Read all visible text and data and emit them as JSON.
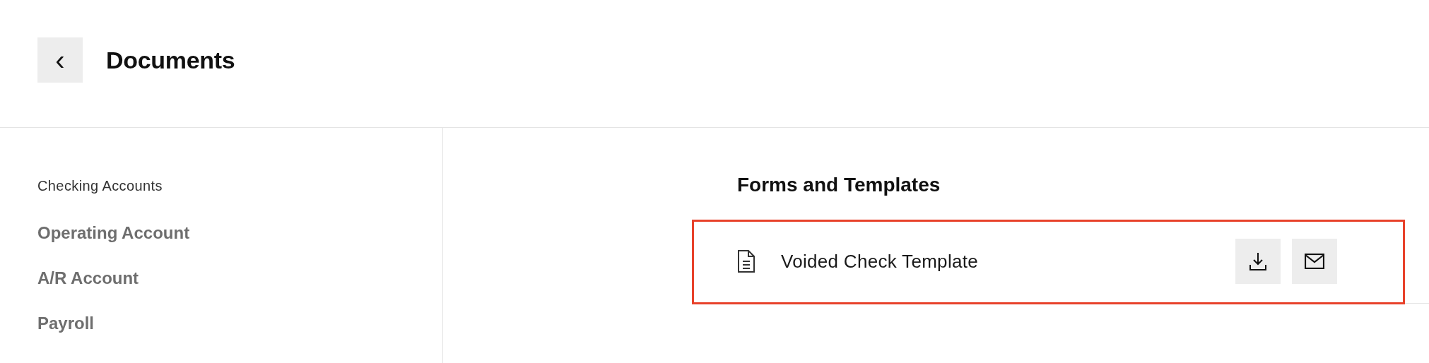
{
  "header": {
    "back_button": "‹",
    "title": "Documents"
  },
  "sidebar": {
    "heading": "Checking Accounts",
    "items": [
      {
        "label": "Operating Account"
      },
      {
        "label": "A/R Account"
      },
      {
        "label": "Payroll"
      }
    ]
  },
  "section": {
    "title": "Forms and Templates",
    "rows": [
      {
        "name": "Voided Check Template",
        "highlighted": true
      }
    ]
  }
}
